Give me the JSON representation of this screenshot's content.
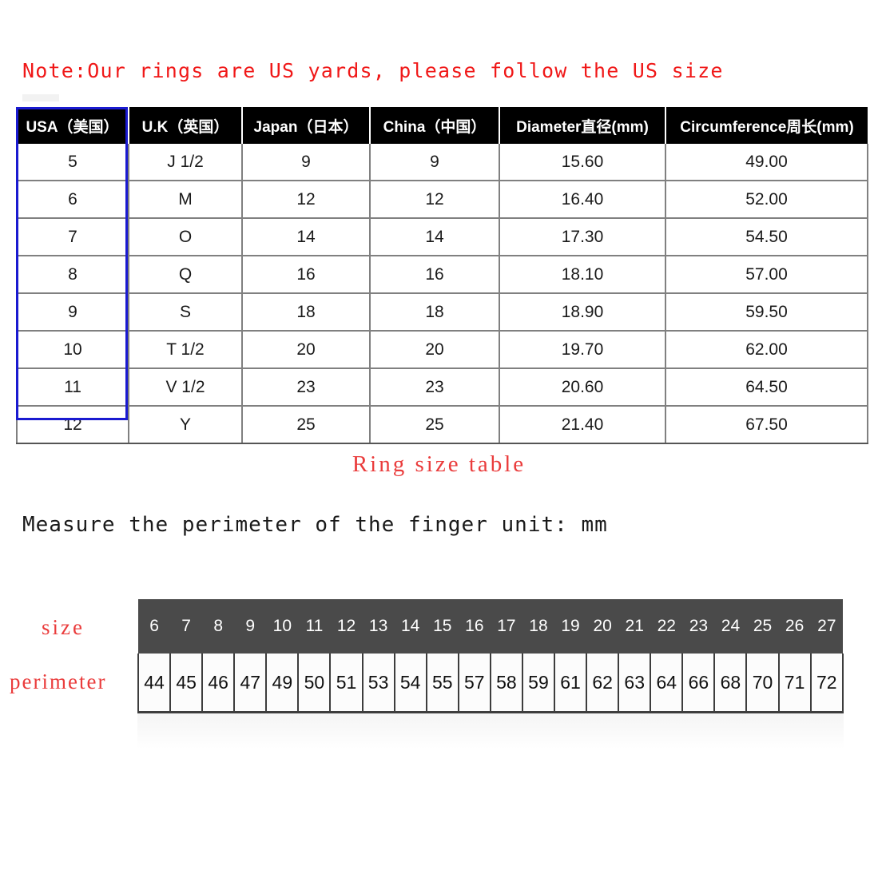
{
  "note": "Note:Our rings are US yards, please follow the US size",
  "caption": "Ring size table",
  "measure_line": "Measure the perimeter of the finger unit: mm",
  "colors": {
    "note_red": "#f01818",
    "caption_red": "#ea3c3c",
    "header_bg": "#000000",
    "header_text": "#ffffff",
    "usa_highlight_border": "#1a1ad0",
    "ruler_size_bg": "#4a4a4a"
  },
  "size_table": {
    "headers": [
      "USA（美国）",
      "U.K（英国）",
      "Japan（日本）",
      "China（中国）",
      "Diameter直径(mm)",
      "Circumference周长(mm)"
    ],
    "rows": [
      [
        "5",
        "J 1/2",
        "9",
        "9",
        "15.60",
        "49.00"
      ],
      [
        "6",
        "M",
        "12",
        "12",
        "16.40",
        "52.00"
      ],
      [
        "7",
        "O",
        "14",
        "14",
        "17.30",
        "54.50"
      ],
      [
        "8",
        "Q",
        "16",
        "16",
        "18.10",
        "57.00"
      ],
      [
        "9",
        "S",
        "18",
        "18",
        "18.90",
        "59.50"
      ],
      [
        "10",
        "T 1/2",
        "20",
        "20",
        "19.70",
        "62.00"
      ],
      [
        "11",
        "V 1/2",
        "23",
        "23",
        "20.60",
        "64.50"
      ],
      [
        "12",
        "Y",
        "25",
        "25",
        "21.40",
        "67.50"
      ]
    ]
  },
  "ruler": {
    "size_label": "size",
    "perimeter_label": "perimeter",
    "sizes": [
      "6",
      "7",
      "8",
      "9",
      "10",
      "11",
      "12",
      "13",
      "14",
      "15",
      "16",
      "17",
      "18",
      "19",
      "20",
      "21",
      "22",
      "23",
      "24",
      "25",
      "26",
      "27"
    ],
    "perimeters": [
      "44",
      "45",
      "46",
      "47",
      "49",
      "50",
      "51",
      "53",
      "54",
      "55",
      "57",
      "58",
      "59",
      "61",
      "62",
      "63",
      "64",
      "66",
      "68",
      "70",
      "71",
      "72"
    ]
  }
}
